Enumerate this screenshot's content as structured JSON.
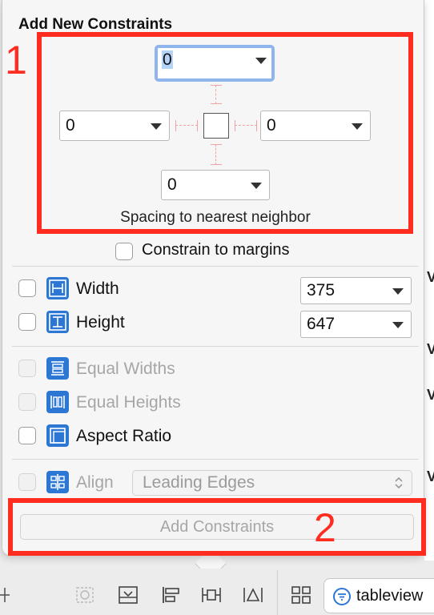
{
  "popover": {
    "title": "Add New Constraints",
    "spacing": {
      "top_value": "0",
      "left_value": "0",
      "right_value": "0",
      "bottom_value": "0",
      "caption": "Spacing to nearest neighbor"
    },
    "constrain_to_margins": "Constrain to margins",
    "width": {
      "label": "Width",
      "value": "375"
    },
    "height": {
      "label": "Height",
      "value": "647"
    },
    "equal_widths": "Equal Widths",
    "equal_heights": "Equal Heights",
    "aspect_ratio": "Aspect Ratio",
    "align": {
      "label": "Align",
      "value": "Leading Edges"
    },
    "add_button": "Add Constraints"
  },
  "annotations": {
    "box1": "1",
    "box2": "2"
  },
  "toolbar": {
    "search_text": "tableview"
  },
  "colors": {
    "annotation_red": "#ff2d1f",
    "icon_blue": "#2d77d4",
    "focus_blue": "#8fb6ec"
  }
}
